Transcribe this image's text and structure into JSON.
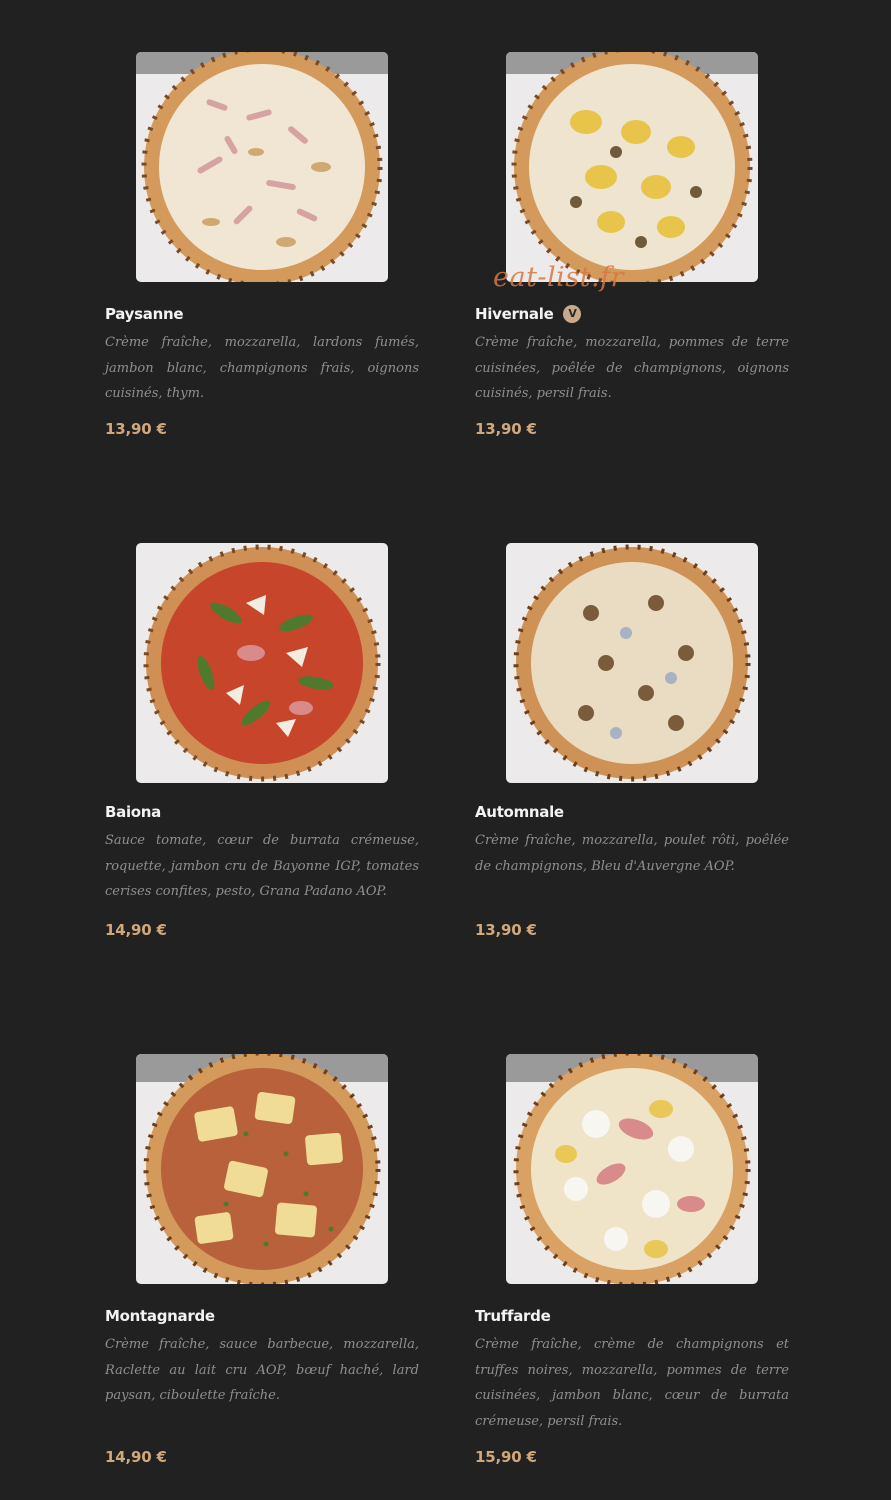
{
  "watermark": "eat-list.fr",
  "colors": {
    "background": "#212121",
    "name": "#f3f3f3",
    "description": "#8f8f8f",
    "price": "#d2a77c",
    "badge": "#c8a98c",
    "watermark": "#d9773f"
  },
  "pizzas": [
    {
      "name": "Paysanne",
      "description": "Crème fraîche, mozzarella, lardons fumés, jambon blanc, champignons frais, oignons cuisinés, thym.",
      "price": "13,90 €",
      "badge": "",
      "image": "pizza-paysanne-photo"
    },
    {
      "name": "Hivernale",
      "description": "Crème fraîche, mozzarella, pommes de terre cuisinées, poêlée de champignons, oignons cuisinés, persil frais.",
      "price": "13,90 €",
      "badge": "V",
      "image": "pizza-hivernale-photo"
    },
    {
      "name": "Baiona",
      "description": "Sauce tomate, cœur de burrata crémeuse, roquette, jambon cru de Bayonne IGP, tomates cerises confites, pesto, Grana Padano AOP.",
      "price": "14,90 €",
      "badge": "",
      "image": "pizza-baiona-photo"
    },
    {
      "name": "Automnale",
      "description": "Crème fraîche, mozzarella, poulet rôti, poêlée de champignons, Bleu d'Auvergne AOP.",
      "price": "13,90 €",
      "badge": "",
      "image": "pizza-automnale-photo"
    },
    {
      "name": "Montagnarde",
      "description": "Crème fraîche, sauce barbecue, mozzarella, Raclette au lait cru AOP, bœuf haché, lard paysan, ciboulette fraîche.",
      "price": "14,90 €",
      "badge": "",
      "image": "pizza-montagnarde-photo"
    },
    {
      "name": "Truffarde",
      "description": "Crème fraîche, crème de champignons et truffes noires, mozzarella, pommes de terre cuisinées, jambon blanc, cœur de burrata crémeuse, persil frais.",
      "price": "15,90 €",
      "badge": "",
      "image": "pizza-truffarde-photo"
    }
  ]
}
